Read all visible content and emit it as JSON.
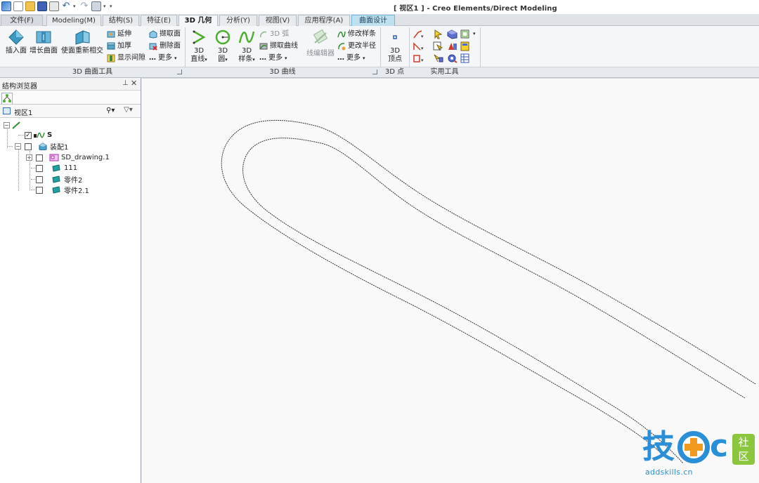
{
  "window": {
    "title": "[ 视区1 ] - Creo Elements/Direct Modeling"
  },
  "quick_access": {
    "icons": [
      "app-icon",
      "new-icon",
      "open-icon",
      "save-icon",
      "print-preview-icon",
      "undo-icon",
      "redo-icon",
      "tool-icon"
    ]
  },
  "tabs": [
    {
      "label": "文件(F)"
    },
    {
      "label": "Modeling(M)"
    },
    {
      "label": "结构(S)"
    },
    {
      "label": "特征(E)"
    },
    {
      "label": "3D 几何"
    },
    {
      "label": "分析(Y)"
    },
    {
      "label": "视图(V)"
    },
    {
      "label": "应用程序(A)"
    },
    {
      "label": "曲面设计"
    }
  ],
  "active_tab": "3D 几何",
  "ribbon": {
    "surface_tools": {
      "label": "3D 曲面工具",
      "insert_face": "插入面",
      "extend_surface": "增长曲面",
      "make_faces_intersect": "使面重新相交",
      "extend": "延伸",
      "thicken": "加厚",
      "show_gap": "显示间隙",
      "extract_face": "撷取面",
      "delete_face": "删除面",
      "more": "更多"
    },
    "curves": {
      "label": "3D 曲线",
      "line_top": "3D",
      "line_bottom": "直线",
      "circle_top": "3D",
      "circle_bottom": "圆",
      "spline_top": "3D",
      "spline_bottom": "样条",
      "arc": "3D 弧",
      "extract_curve": "撷取曲线",
      "more1": "更多",
      "line_editor": "线编辑器",
      "modify_spline": "修改样条",
      "change_radius": "更改半径",
      "more2": "更多"
    },
    "points": {
      "label": "3D 点",
      "vertex_top": "3D",
      "vertex_bottom": "顶点"
    },
    "utilities": {
      "label": "实用工具"
    }
  },
  "panel": {
    "title": "结构浏览器",
    "view_label": "视区1",
    "tree": [
      {
        "label": "S",
        "checked": true
      },
      {
        "label": "装配1",
        "checked": false
      },
      {
        "label": "SD_drawing.1",
        "checked": false
      },
      {
        "label": "111",
        "checked": false
      },
      {
        "label": "零件2",
        "checked": false
      },
      {
        "label": "零件2.1",
        "checked": false
      }
    ]
  },
  "viewport": {
    "background": "#f9f9f9",
    "curve_color": "#333333"
  },
  "watermark": {
    "char1": "技",
    "char2": "c",
    "box_line1": "社",
    "box_line2": "区",
    "url": "addskills.cn",
    "color": "#2a8fd6",
    "accent": "#f29a1e",
    "box_color": "#8cc63f"
  }
}
